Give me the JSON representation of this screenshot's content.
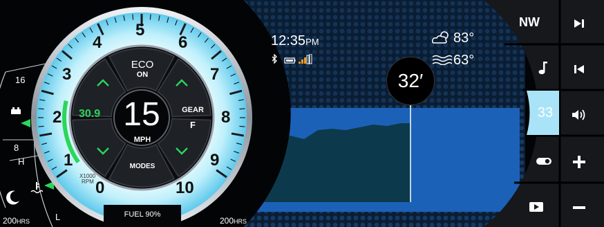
{
  "gauge": {
    "rpm_ticks": [
      "0",
      "1",
      "2",
      "3",
      "4",
      "5",
      "6",
      "7",
      "8",
      "9",
      "10"
    ],
    "rpm_unit_line1": "X1000",
    "rpm_unit_line2": "RPM",
    "rpm_fraction": 0.19
  },
  "center": {
    "speed": "15",
    "speed_unit": "MPH",
    "trim_value": "30.9",
    "eco_label": "ECO",
    "eco_state": "ON",
    "gear_label": "GEAR",
    "gear_value": "F",
    "modes_label": "MODES"
  },
  "left_scale": {
    "fuel_top": "16",
    "fuel_bottom": "8",
    "temp_high": "H",
    "temp_low": "L",
    "engine_hours_left": "200",
    "hours_unit_left": "HRS"
  },
  "bottom": {
    "fuel_status": "FUEL 90%",
    "engine_hours_right": "200",
    "hours_unit_right": "HRS"
  },
  "depth_panel": {
    "time": "12:35",
    "ampm": "PM",
    "air_temp": "83°",
    "water_temp": "63°",
    "depth": "32′"
  },
  "right_controls": {
    "heading": "NW",
    "volume_level": "33"
  },
  "icons": [
    "moon-icon",
    "fuel-pump-icon",
    "battery-icon",
    "water-temp-icon",
    "bluetooth-icon",
    "battery-status-icon",
    "signal-bars-icon",
    "partly-cloudy-icon",
    "water-waves-icon",
    "music-note-icon",
    "skip-forward-icon",
    "skip-back-icon",
    "speaker-icon",
    "toggle-icon",
    "plus-icon",
    "minus-icon",
    "play-icon"
  ],
  "colors": {
    "accent_green": "#2bd65a",
    "gauge_glow": "#bfeefb",
    "volume_highlight": "#a9e3f8",
    "water_blue": "#1a5fb6",
    "seabed": "#0c3a4c"
  }
}
